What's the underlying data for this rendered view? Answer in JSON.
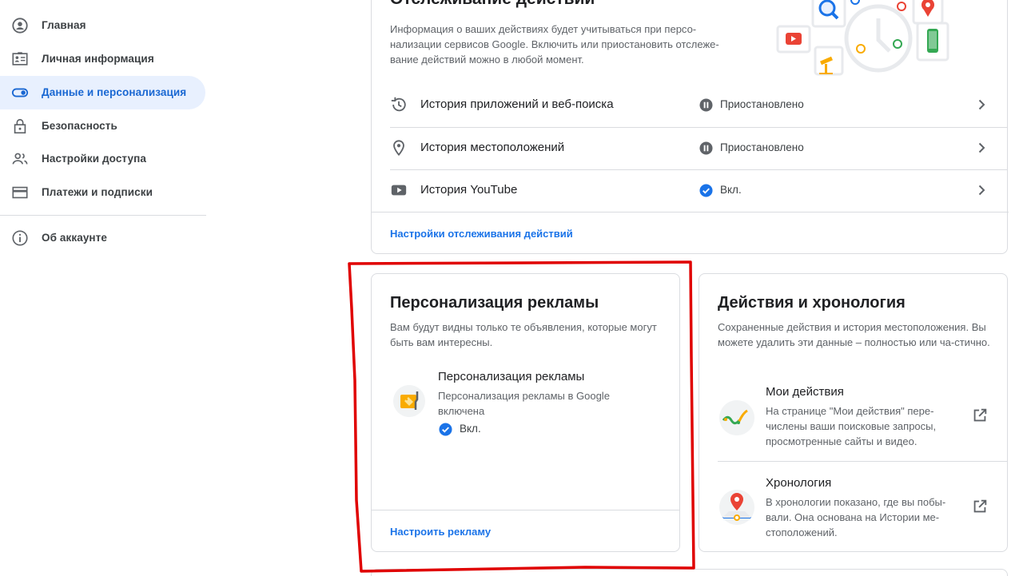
{
  "sidebar": {
    "items": [
      {
        "label": "Главная",
        "icon": "account-circle-icon"
      },
      {
        "label": "Личная информация",
        "icon": "id-card-icon"
      },
      {
        "label": "Данные и персонализация",
        "icon": "toggle-icon",
        "active": true
      },
      {
        "label": "Безопасность",
        "icon": "lock-icon"
      },
      {
        "label": "Настройки доступа",
        "icon": "people-icon"
      },
      {
        "label": "Платежи и подписки",
        "icon": "credit-card-icon"
      },
      {
        "label": "Об аккаунте",
        "icon": "info-icon"
      }
    ]
  },
  "activity_controls": {
    "title": "Отслеживание действий",
    "description": "Информация о ваших действиях будет учитываться при персо-нализации сервисов Google. Включить или приостановить отслеже-вание действий можно в любой момент.",
    "rows": [
      {
        "label": "История приложений и веб-поиска",
        "status": "Приостановлено",
        "icon": "history-icon",
        "status_icon": "pause-icon"
      },
      {
        "label": "История местоположений",
        "status": "Приостановлено",
        "icon": "location-pin-icon",
        "status_icon": "pause-icon"
      },
      {
        "label": "История YouTube",
        "status": "Вкл.",
        "icon": "youtube-icon",
        "status_icon": "check-circle-icon"
      }
    ],
    "link": "Настройки отслеживания действий"
  },
  "ads_card": {
    "title": "Персонализация рекламы",
    "description": "Вам будут видны только те объявления, которые могут быть вам интересны.",
    "sub_title": "Персонализация рекламы",
    "sub_desc": "Персонализация рекламы в Google включена",
    "status": "Вкл.",
    "link": "Настроить рекламу"
  },
  "activity_card": {
    "title": "Действия и хронология",
    "description": "Сохраненные действия и история местоположения. Вы можете удалить эти данные – полностью или ча-стично.",
    "items": [
      {
        "title": "Мои действия",
        "desc": "На странице \"Мои действия\" пере-числены ваши поисковые запросы, просмотренные сайты и видео."
      },
      {
        "title": "Хронология",
        "desc": "В хронологии показано, где вы побы-вали. Она основана на Истории ме-стоположений."
      }
    ]
  },
  "colors": {
    "accent": "#1a73e8",
    "active_bg": "#e8f0fe",
    "annotation": "#e00000"
  }
}
